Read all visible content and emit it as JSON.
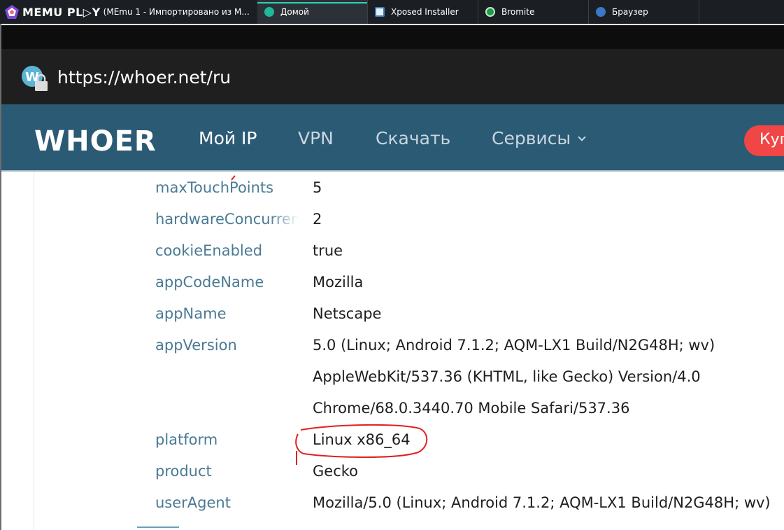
{
  "emulator": {
    "brand": "MEMU PL▷Y",
    "window_title": "(MEmu 1 - Импортировано из М...",
    "tabs": [
      {
        "label": "Домой",
        "icon": "home-icon",
        "active": true
      },
      {
        "label": "Xposed Installer",
        "icon": "xposed-icon",
        "active": false
      },
      {
        "label": "Bromite",
        "icon": "bromite-icon",
        "active": false
      },
      {
        "label": "Браузер",
        "icon": "globe-icon",
        "active": false
      }
    ]
  },
  "browser": {
    "url": "https://whoer.net/ru"
  },
  "site": {
    "logo": "WHOER",
    "nav": [
      {
        "label": "Мой IP"
      },
      {
        "label": "VPN"
      },
      {
        "label": "Скачать"
      },
      {
        "label": "Сервисы"
      }
    ],
    "buy_button": "Куп"
  },
  "navigator_props": [
    {
      "key": "maxTouchPoints",
      "value": "5"
    },
    {
      "key": "hardwareConcurrency",
      "value": "2"
    },
    {
      "key": "cookieEnabled",
      "value": "true"
    },
    {
      "key": "appCodeName",
      "value": "Mozilla"
    },
    {
      "key": "appName",
      "value": "Netscape"
    },
    {
      "key": "appVersion",
      "value": "5.0 (Linux; Android 7.1.2; AQM-LX1 Build/N2G48H; wv)"
    },
    {
      "key": "",
      "value": "AppleWebKit/537.36 (KHTML, like Gecko) Version/4.0"
    },
    {
      "key": "",
      "value": "Chrome/68.0.3440.70 Mobile Safari/537.36"
    },
    {
      "key": "platform",
      "value": "Linux x86_64"
    },
    {
      "key": "product",
      "value": "Gecko"
    },
    {
      "key": "userAgent",
      "value": "Mozilla/5.0 (Linux; Android 7.1.2; AQM-LX1 Build/N2G48H; wv)"
    }
  ],
  "colors": {
    "header_bg": "#2b5a75",
    "key_text": "#4a7a93",
    "buy_button": "#f04646",
    "annotation": "#e02020"
  }
}
